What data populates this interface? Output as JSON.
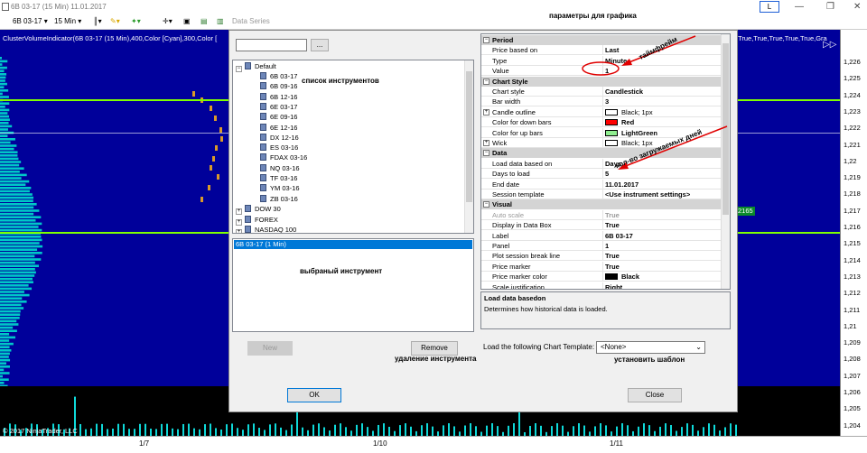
{
  "window": {
    "title": "6B 03-17 (15 Min)  11.01.2017",
    "l_button": "L",
    "controls": [
      "—",
      "❐",
      "✕"
    ]
  },
  "toolbar": {
    "instrument": "6B 03-17",
    "interval": "15 Min",
    "data_series": "Data Series"
  },
  "chart": {
    "indicator_info": "ClusterVolumeIndicator(6B 03-17  (15 Min),400,Color [Cyan],300,Color [",
    "indicator_info_right": ",True,True,True,True,True,Gra",
    "copyright": "© 2017 NinjaTrader, LLC",
    "x_labels": [
      "1/7",
      "1/10",
      "1/11"
    ],
    "y_labels": [
      "1,226",
      "1,225",
      "1,224",
      "1,223",
      "1,222",
      "1,221",
      "1,22",
      "1,219",
      "1,218",
      "1,217",
      "1,216",
      "1,215",
      "1,214",
      "1,213",
      "1,212",
      "1,211",
      "1,21",
      "1,209",
      "1,208",
      "1,207",
      "1,206",
      "1,205",
      "1,204"
    ],
    "price_marker": "2165"
  },
  "dialog": {
    "search_button": "...",
    "tree": {
      "root": "Default",
      "items": [
        "6B 03-17",
        "6B 09-16",
        "6B 12-16",
        "6E 03-17",
        "6E 09-16",
        "6E 12-16",
        "DX 12-16",
        "ES 03-16",
        "FDAX 03-16",
        "NQ 03-16",
        "TF 03-16",
        "YM 03-16",
        "ZB 03-16"
      ],
      "groups": [
        "DOW 30",
        "FOREX",
        "NASDAQ 100"
      ]
    },
    "selected": "6B 03-17 (1 Min)",
    "new_button": "New",
    "remove_button": "Remove",
    "ok_button": "OK",
    "close_button": "Close",
    "template_label": "Load the following Chart Template:",
    "template_value": "<None>",
    "props": {
      "period": {
        "title": "Period",
        "rows": [
          {
            "k": "Price based on",
            "v": "Last"
          },
          {
            "k": "Type",
            "v": "Minute"
          },
          {
            "k": "Value",
            "v": "1"
          }
        ]
      },
      "chart_style": {
        "title": "Chart Style",
        "rows": [
          {
            "k": "Chart style",
            "v": "Candlestick"
          },
          {
            "k": "Bar width",
            "v": "3"
          },
          {
            "k": "Candle outline",
            "v": "Black; 1px"
          },
          {
            "k": "Color for down bars",
            "v": "Red"
          },
          {
            "k": "Color for up bars",
            "v": "LightGreen"
          },
          {
            "k": "Wick",
            "v": "Black; 1px"
          }
        ]
      },
      "data": {
        "title": "Data",
        "rows": [
          {
            "k": "Load data based on",
            "v": "Days"
          },
          {
            "k": "Days to load",
            "v": "5"
          },
          {
            "k": "End date",
            "v": "11.01.2017"
          },
          {
            "k": "Session template",
            "v": "<Use instrument settings>"
          }
        ]
      },
      "visual": {
        "title": "Visual",
        "rows": [
          {
            "k": "Auto scale",
            "v": "True"
          },
          {
            "k": "Display in Data Box",
            "v": "True"
          },
          {
            "k": "Label",
            "v": "6B 03-17"
          },
          {
            "k": "Panel",
            "v": "1"
          },
          {
            "k": "Plot session break line",
            "v": "True"
          },
          {
            "k": "Price marker",
            "v": "True"
          },
          {
            "k": "Price marker color",
            "v": "Black"
          },
          {
            "k": "Scale justification",
            "v": "Right"
          }
        ]
      }
    },
    "description": {
      "title": "Load data basedon",
      "text": "Determines how historical data is loaded."
    }
  },
  "annotations": {
    "params": "параметры для графика",
    "instruments": "список инструментов",
    "selected": "выбраный инструмент",
    "remove": "удаление инструмента",
    "template": "установить шаблон",
    "timeframe": "таймфрейм",
    "days": "кол-во загружаемых дней"
  },
  "colors": {
    "chart_bg": "#00009a",
    "green_line": "#7fff00",
    "swatch_red": "#ff0000",
    "swatch_green": "#90ee90",
    "swatch_black": "#000000",
    "selection": "#0078d7",
    "arrow": "#e00000"
  }
}
